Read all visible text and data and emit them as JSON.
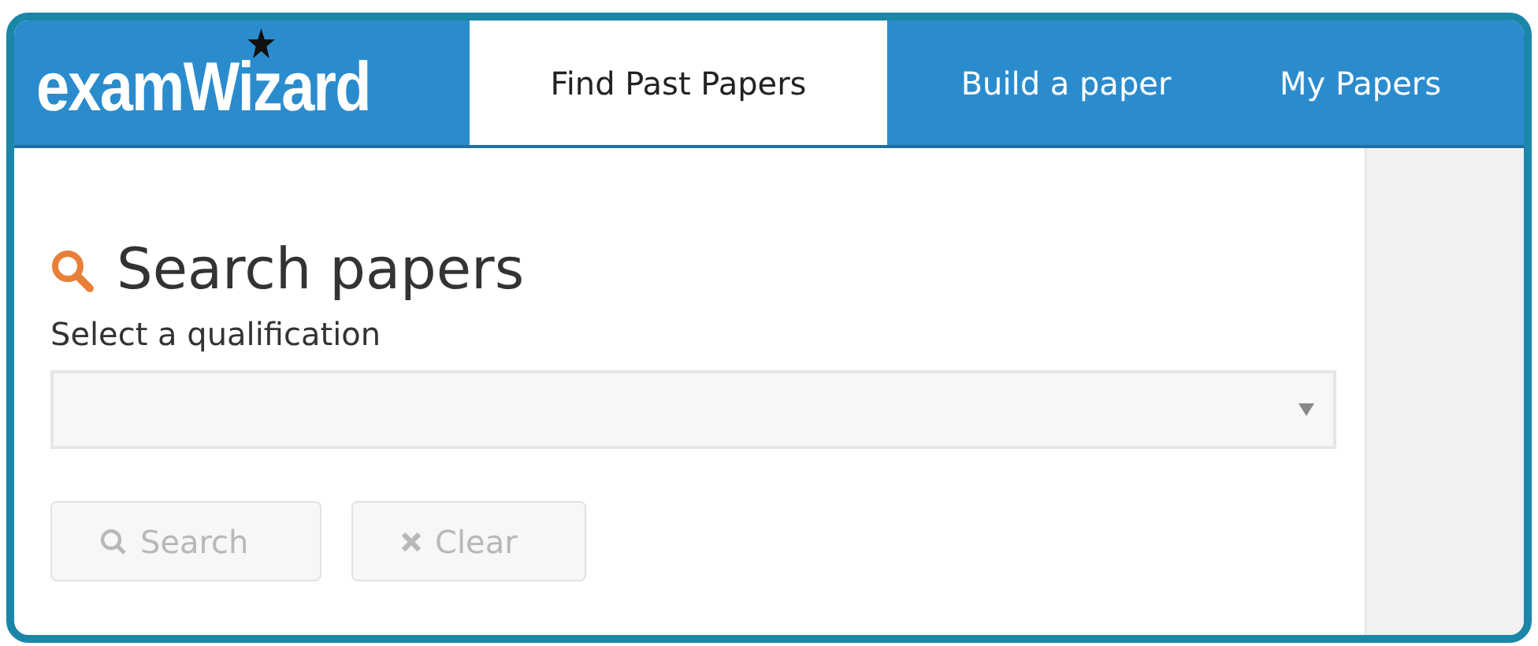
{
  "logo": "examWizard",
  "tabs": [
    {
      "label": "Find Past Papers",
      "selected": true
    },
    {
      "label": "Build a paper",
      "selected": false
    },
    {
      "label": "My Papers",
      "selected": false
    }
  ],
  "heading": "Search papers",
  "qualification": {
    "label": "Select a qualification"
  },
  "buttons": [
    {
      "label": "Search",
      "kind": "search",
      "disabled": true
    },
    {
      "label": "Clear",
      "kind": "clear",
      "disabled": true
    }
  ]
}
